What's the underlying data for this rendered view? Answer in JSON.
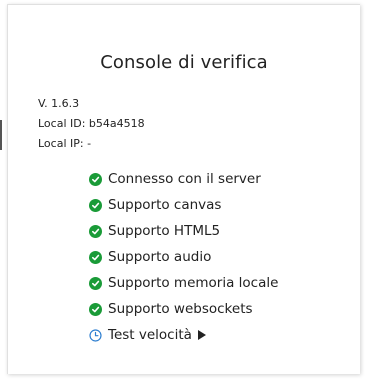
{
  "title": "Console di verifica",
  "meta": {
    "version": "V. 1.6.3",
    "local_id": "Local ID: b54a4518",
    "local_ip": "Local IP: -"
  },
  "checks": [
    {
      "label": "Connesso con il server",
      "status": "ok"
    },
    {
      "label": "Supporto canvas",
      "status": "ok"
    },
    {
      "label": "Supporto HTML5",
      "status": "ok"
    },
    {
      "label": "Supporto audio",
      "status": "ok"
    },
    {
      "label": "Supporto memoria locale",
      "status": "ok"
    },
    {
      "label": "Supporto websockets",
      "status": "ok"
    }
  ],
  "speed_test": {
    "label": "Test velocità",
    "icon": "clock-icon",
    "action_icon": "play-icon"
  },
  "colors": {
    "ok": "#1a9b38",
    "pending": "#2f7fd0"
  }
}
